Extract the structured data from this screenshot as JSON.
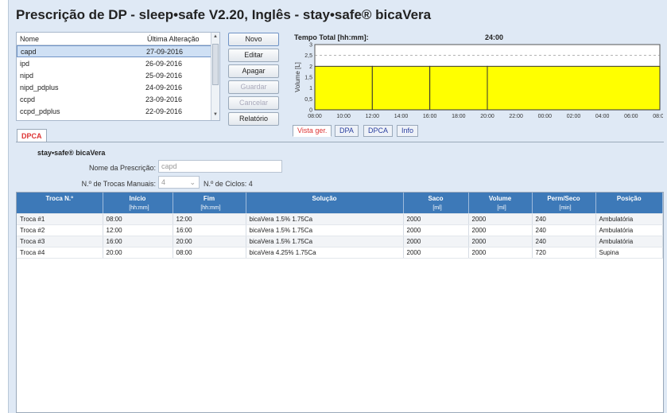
{
  "title": "Prescrição de DP - sleep•safe V2.20, Inglês - stay•safe® bicaVera",
  "prescriptions": {
    "col_name": "Nome",
    "col_date": "Última Alteração",
    "rows": [
      {
        "name": "capd",
        "date": "27-09-2016"
      },
      {
        "name": "ipd",
        "date": "26-09-2016"
      },
      {
        "name": "nipd",
        "date": "25-09-2016"
      },
      {
        "name": "nipd_pdplus",
        "date": "24-09-2016"
      },
      {
        "name": "ccpd",
        "date": "23-09-2016"
      },
      {
        "name": "ccpd_pdplus",
        "date": "22-09-2016"
      }
    ],
    "selected": "capd"
  },
  "buttons": {
    "novo": "Novo",
    "editar": "Editar",
    "apagar": "Apagar",
    "guardar": "Guardar",
    "cancelar": "Cancelar",
    "relatorio": "Relatório"
  },
  "chart_header": {
    "label": "Tempo Total [hh:mm]:",
    "value": "24:00"
  },
  "chart_data": {
    "type": "area",
    "ylabel": "Volume [L]",
    "xlabel": "",
    "yticks": [
      "0",
      "0,5",
      "1",
      "1,5",
      "2",
      "2,5",
      "3"
    ],
    "ylim": [
      0,
      3
    ],
    "xticks": [
      "08:00",
      "10:00",
      "12:00",
      "14:00",
      "16:00",
      "18:00",
      "20:00",
      "22:00",
      "00:00",
      "02:00",
      "04:00",
      "06:00",
      "08:00"
    ],
    "xlim_hours": [
      0,
      24
    ],
    "segments": [
      {
        "start_h": 0,
        "end_h": 4,
        "volume_l": 2
      },
      {
        "start_h": 4,
        "end_h": 8,
        "volume_l": 2
      },
      {
        "start_h": 8,
        "end_h": 12,
        "volume_l": 2
      },
      {
        "start_h": 12,
        "end_h": 24,
        "volume_l": 2
      }
    ],
    "fill_color": "#ffff00"
  },
  "chart_tabs": [
    "Vista ger.",
    "DPA",
    "DPCA",
    "Info"
  ],
  "chart_tab_active": "Vista ger.",
  "main_tab": "DPCA",
  "device": "stay•safe® bicaVera",
  "form": {
    "name_label": "Nome da Prescrição:",
    "name_value": "capd",
    "manual_label": "N.º de Trocas Manuais:",
    "manual_value": "4",
    "cycles_label": "N.º de Ciclos: 4"
  },
  "table": {
    "headers": [
      "Troca N.º",
      "Início",
      "Fim",
      "Solução",
      "Saco",
      "Volume",
      "Perm/Seco",
      "Posição"
    ],
    "units": [
      "",
      "[hh:mm]",
      "[hh:mm]",
      "",
      "[ml]",
      "[ml]",
      "[min]",
      ""
    ],
    "rows": [
      [
        "Troca #1",
        "08:00",
        "12:00",
        "bicaVera 1.5% 1.75Ca",
        "2000",
        "2000",
        "240",
        "Ambulatória"
      ],
      [
        "Troca #2",
        "12:00",
        "16:00",
        "bicaVera 1.5% 1.75Ca",
        "2000",
        "2000",
        "240",
        "Ambulatória"
      ],
      [
        "Troca #3",
        "16:00",
        "20:00",
        "bicaVera 1.5% 1.75Ca",
        "2000",
        "2000",
        "240",
        "Ambulatória"
      ],
      [
        "Troca #4",
        "20:00",
        "08:00",
        "bicaVera 4.25% 1.75Ca",
        "2000",
        "2000",
        "720",
        "Supina"
      ]
    ]
  }
}
